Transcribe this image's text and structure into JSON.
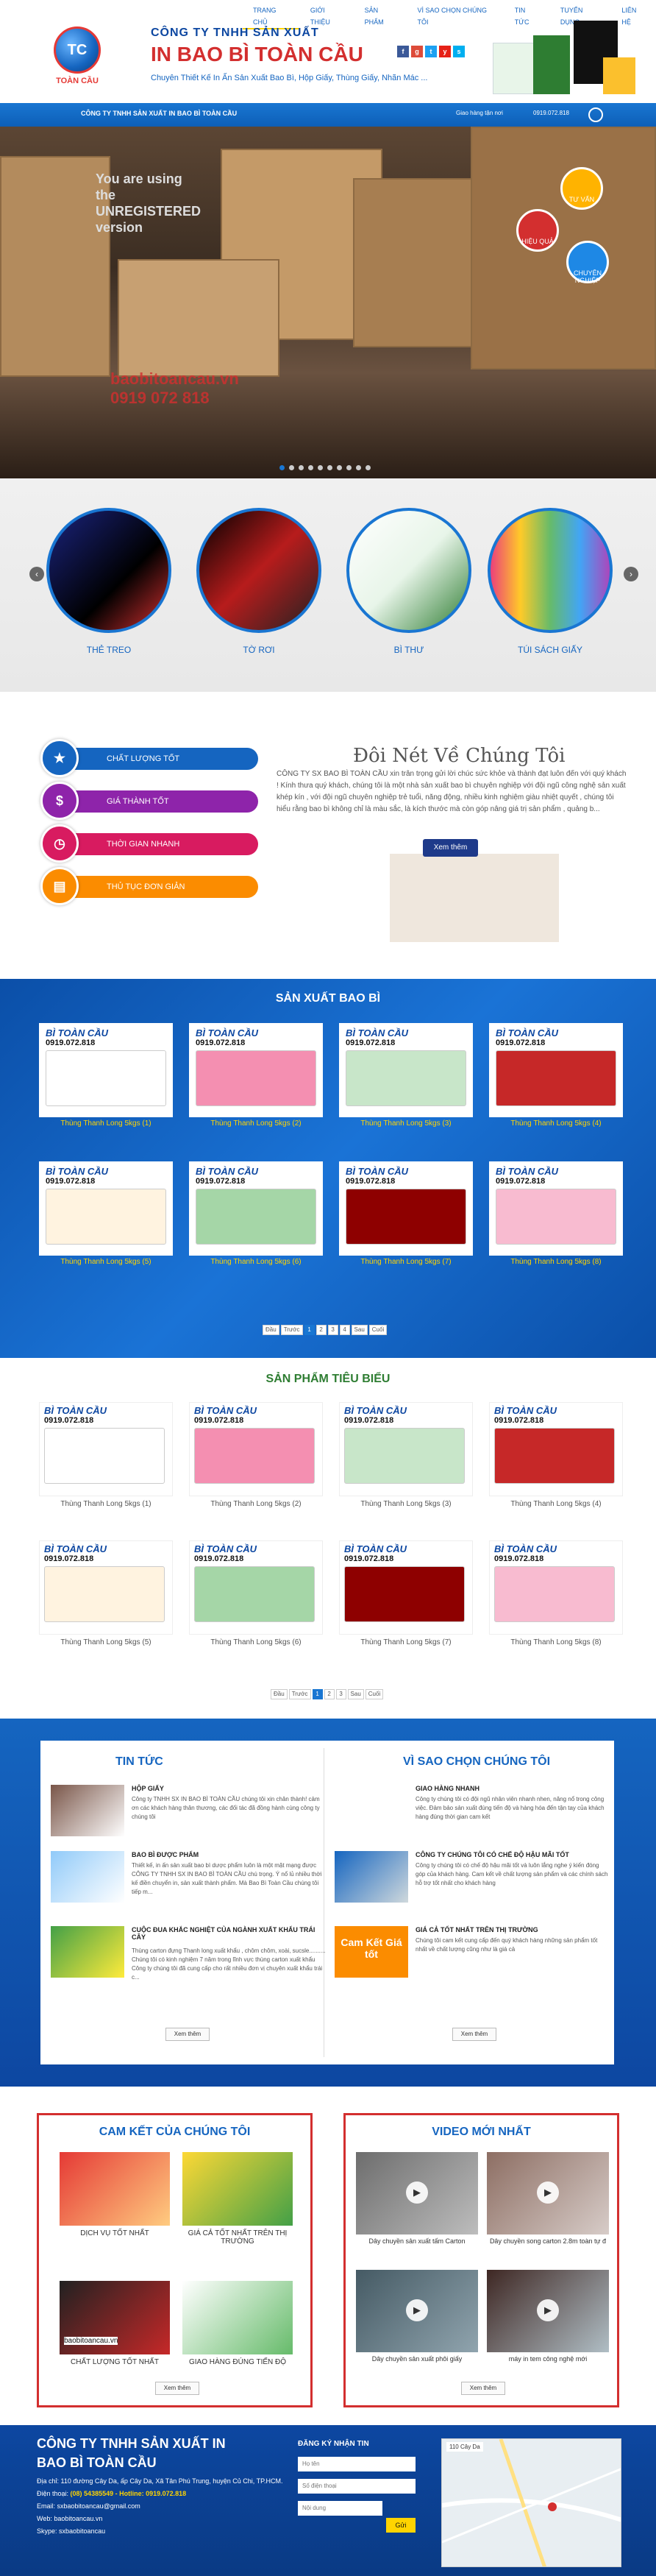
{
  "header": {
    "logo_text": "TC",
    "logo_caption": "TOÀN CẦU",
    "company": "CÔNG TY TNHH SẢN XUẤT",
    "brand": "IN BAO BÌ TOÀN CẦU",
    "slogan": "Chuyên Thiết Kế In Ấn Sản Xuất Bao Bì, Hộp Giấy, Thùng Giấy, Nhãn Mác ...",
    "nav": [
      "TRANG CHỦ",
      "GIỚI THIỆU",
      "SẢN PHẨM",
      "VÌ SAO CHỌN CHÚNG TÔI",
      "TIN TỨC",
      "TUYỂN DỤNG",
      "LIÊN HỆ"
    ],
    "socials": [
      "f",
      "g",
      "t",
      "y",
      "s"
    ]
  },
  "bluebar": {
    "title": "CÔNG TY TNHH SẢN XUẤT IN BAO BÌ TOÀN CẦU",
    "address": "Giao hàng tận nơi",
    "phone": "0919.072.818"
  },
  "slider": {
    "watermark_top": "You are using the UNREGISTERED version",
    "watermark_bottom": "baobitoancau.vn 0919 072 818",
    "bubbles": [
      "TƯ VẤN",
      "HIỆU QUẢ",
      "CHUYÊN NGHIỆP"
    ]
  },
  "categories": [
    "THẺ TREO",
    "TỜ RƠI",
    "BÌ THƯ",
    "TÚI SÁCH GIẤY"
  ],
  "about": {
    "tabs": [
      "CHẤT LƯỢNG TỐT",
      "GIÁ THÀNH TỐT",
      "THỜI GIAN NHANH",
      "THỦ TỤC ĐƠN GIẢN"
    ],
    "title": "Đôi Nét Về Chúng Tôi",
    "text": "CÔNG TY SX BAO BÌ TOÀN CẦU xin trân trọng gửi lời chúc sức khỏe và thành đạt luôn đến với quý khách ! Kính thưa quý khách, chúng tôi là một nhà sản xuất bao bì chuyên nghiệp với đội ngũ công nghệ sản xuất khép kín , với đội ngũ chuyên nghiệp trẻ tuổi, năng động, nhiều kinh nghiệm giàu nhiệt quyết , chúng tôi hiểu rằng bao bì không chỉ là màu sắc, là kích thước mà còn góp nâng giá trị sản phẩm , quảng b...",
    "button": "Xem thêm"
  },
  "production": {
    "title": "SẢN XUẤT BAO BÌ",
    "brand_tag": "BÌ TOÀN CẦU",
    "phone_tag": "0919.072.818",
    "items": [
      "Thùng Thanh Long 5kgs (1)",
      "Thùng Thanh Long 5kgs (2)",
      "Thùng Thanh Long 5kgs (3)",
      "Thùng Thanh Long 5kgs (4)",
      "Thùng Thanh Long 5kgs (5)",
      "Thùng Thanh Long 5kgs (6)",
      "Thùng Thanh Long 5kgs (7)",
      "Thùng Thanh Long 5kgs (8)"
    ],
    "box_colors": [
      "#ffffff",
      "#f48fb1",
      "#c8e6c9",
      "#c62828",
      "#fff3e0",
      "#a5d6a7",
      "#8e0000",
      "#f8bbd0"
    ],
    "pagination": [
      "Đầu",
      "Trước",
      "1",
      "2",
      "3",
      "4",
      "Sau",
      "Cuối"
    ]
  },
  "featured": {
    "title": "SẢN PHẨM TIÊU BIỂU",
    "items": [
      "Thùng Thanh Long 5kgs (1)",
      "Thùng Thanh Long 5kgs (2)",
      "Thùng Thanh Long 5kgs (3)",
      "Thùng Thanh Long 5kgs (4)",
      "Thùng Thanh Long 5kgs (5)",
      "Thùng Thanh Long 5kgs (6)",
      "Thùng Thanh Long 5kgs (7)",
      "Thùng Thanh Long 5kgs (8)"
    ],
    "pagination": [
      "Đầu",
      "Trước",
      "1",
      "2",
      "3",
      "Sau",
      "Cuối"
    ]
  },
  "news": {
    "title": "TIN TỨC",
    "items": [
      {
        "title": "HỘP GIẤY",
        "desc": "Công ty TNHH SX IN BAO BÌ TOÀN CẦU chúng tôi xin chân thành! cảm ơn các khách hàng thân thương, các đối tác đã đồng hành cùng công ty chúng tôi"
      },
      {
        "title": "BAO BÌ ĐƯỢC PHẨM",
        "desc": "Thiết kế, in ấn sản xuất bao bì dược phẩm luôn là một mặt mạng được CÔNG TY TNHH SX IN BAO BÌ TOÀN CẦU chú trọng. Ý nổ lủ nhiều thời kế điền chuyển in, sản xuất thành phẩm. Mà Bao Bì Toàn Cầu chúng tôi tiếp m..."
      },
      {
        "title": "CUỘC ĐUA KHẮC NGHIỆT CỦA NGÀNH XUẤT KHẨU TRÁI CÂY",
        "desc": "Thùng carton đựng Thanh long xuất khẩu , chôm chôm, xoài, sucsle.......... Chúng tôi có kinh nghiệm 7 năm trong lĩnh vực thùng carton xuất khẩu Công ty chúng tôi đã cung cấp cho rất nhiều đơn vị chuyên xuất khẩu trái c..."
      }
    ],
    "more": "Xem thêm"
  },
  "why": {
    "title": "VÌ SAO CHỌN CHÚNG TÔI",
    "items": [
      {
        "title": "GIAO HÀNG NHANH",
        "desc": "Công ty chúng tôi có đội ngũ nhân viên nhanh nhen, năng nổ trong công việc. Đảm bảo sản xuất đúng tiến độ và hàng hóa đến tận tay của khách hàng đúng thời gian cam kết"
      },
      {
        "title": "CÔNG TY CHÚNG TÔI CÓ CHẾ ĐỘ HẬU MÃI TỐT",
        "desc": "Công ty chúng tôi có chế độ hậu mãi tốt và luôn lắng nghe ý kiến đóng góp của khách hàng. Cam kết về chất lượng sản phẩm và các chính sách hỗ trợ tốt nhất cho khách hàng"
      },
      {
        "title": "GIÁ CẢ TỐT NHẤT TRÊN THỊ TRƯỜNG",
        "desc": "Chúng tôi cam kết cung cấp đến quý khách hàng những sản phẩm tốt nhất về chất lượng cũng như là giá cả"
      }
    ],
    "badge": "Cam Kết Giá tốt",
    "more": "Xem thêm"
  },
  "commit": {
    "title": "CAM KẾT CỦA CHÚNG TÔI",
    "items": [
      "DỊCH VỤ TỐT NHẤT",
      "GIÁ CẢ TỐT NHẤT TRÊN THỊ TRƯỜNG",
      "CHẤT LƯỢNG TỐT NHẤT",
      "GIAO HÀNG ĐÚNG TIẾN ĐỘ"
    ],
    "watermark": "baobitoancau.vn",
    "more": "Xem thêm"
  },
  "video": {
    "title": "VIDEO MỚI NHẤT",
    "items": [
      "Dây chuyền sản xuất tấm Carton",
      "Dây chuyền song carton 2.8m toàn tự đ",
      "Dây chuyền sản xuất phôi giấy",
      "máy in tem công nghệ mới"
    ],
    "more": "Xem thêm"
  },
  "footer": {
    "name": "CÔNG TY TNHH SẢN XUẤT IN BAO BÌ TOÀN CẦU",
    "address_label": "Địa chỉ:",
    "address": "110 đường Cây Da, ấp Cây Da, Xã Tân Phú Trung, huyện Củ Chi, TP.HCM.",
    "phone_label": "Điện thoại:",
    "phone": "(08) 54385549 - Hotline: 0919.072.818",
    "email_label": "Email:",
    "email": "sxbaobitoancau@gmail.com",
    "web_label": "Web:",
    "web": "baobitoancau.vn",
    "skype_label": "Skype:",
    "skype": "sxbaobitoancau",
    "form_title": "ĐĂNG KÝ NHẬN TIN",
    "form_name": "Họ tên",
    "form_phone": "Số điện thoại",
    "form_content": "Nội dung",
    "form_submit": "Gửi",
    "map_label": "110 Cây Da"
  },
  "colors": {
    "primary": "#1565c0",
    "accent": "#ffd400",
    "brand_red": "#d32f2f"
  }
}
